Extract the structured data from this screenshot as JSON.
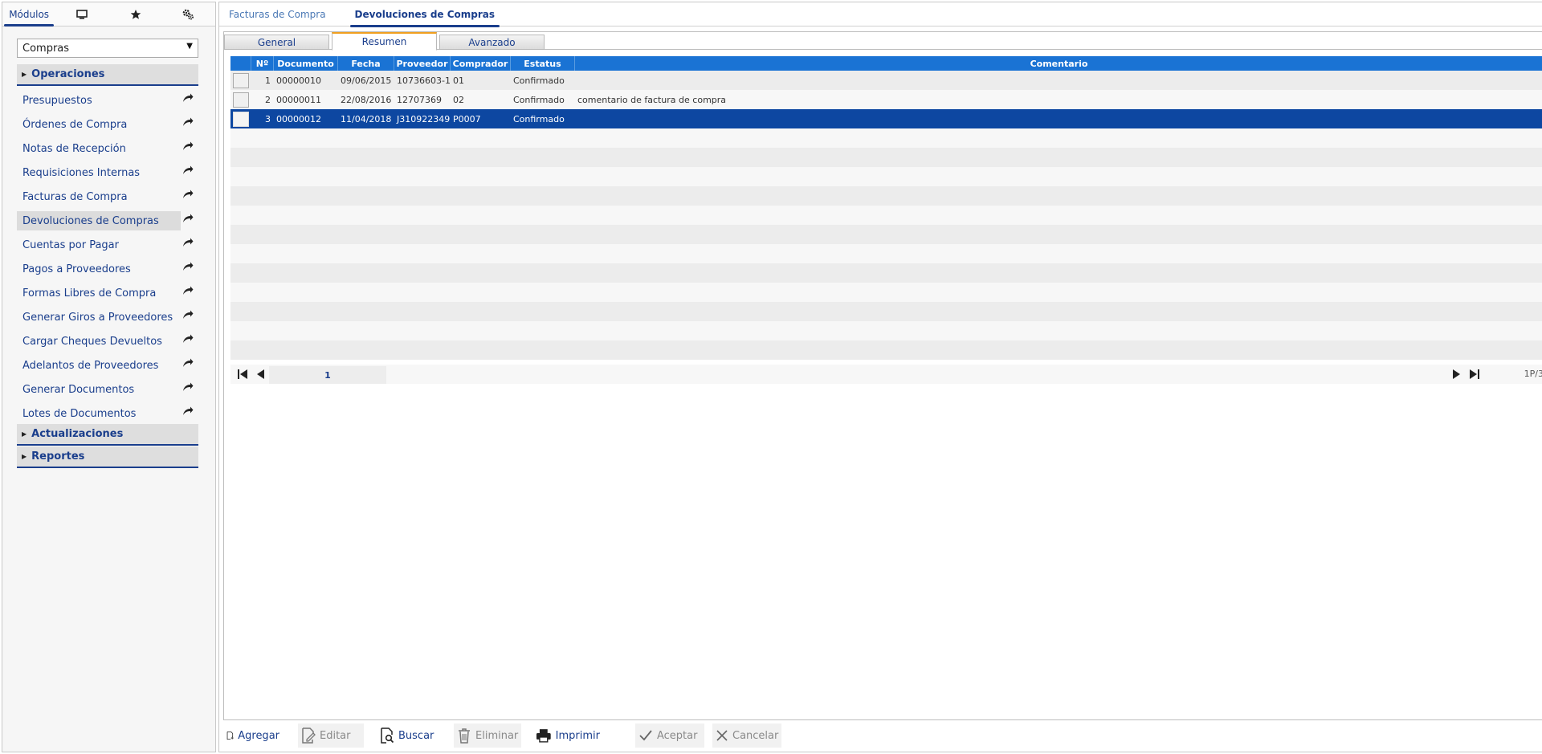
{
  "left_panel": {
    "tabs": [
      {
        "label": "Módulos",
        "icon": null
      },
      {
        "label": "",
        "icon": "monitor-icon"
      },
      {
        "label": "",
        "icon": "star-icon"
      },
      {
        "label": "",
        "icon": "gears-icon"
      }
    ],
    "module_select": {
      "value": "Compras"
    },
    "sections": {
      "operaciones": "Operaciones",
      "actualizaciones": "Actualizaciones",
      "reportes": "Reportes"
    },
    "menu_items": [
      "Presupuestos",
      "Órdenes de Compra",
      "Notas de Recepción",
      "Requisiciones Internas",
      "Facturas de Compra",
      "Devoluciones de Compras",
      "Cuentas por Pagar",
      "Pagos a Proveedores",
      "Formas Libres de Compra",
      "Generar Giros a Proveedores",
      "Cargar Cheques Devueltos",
      "Adelantos de Proveedores",
      "Generar Documentos",
      "Lotes de Documentos"
    ],
    "active_menu_item": "Devoluciones de Compras"
  },
  "document_tabs": [
    "Facturas de Compra",
    "Devoluciones de Compras"
  ],
  "active_document_tab": "Devoluciones de Compras",
  "sub_tabs": [
    "General",
    "Resumen",
    "Avanzado"
  ],
  "active_sub_tab": "Resumen",
  "grid": {
    "columns": [
      "Nº",
      "Documento",
      "Fecha",
      "Proveedor",
      "Comprador",
      "Estatus",
      "Comentario"
    ],
    "rows": [
      {
        "n": "1",
        "documento": "00000010",
        "fecha": "09/06/2015",
        "proveedor": "10736603-1",
        "comprador": "01",
        "estatus": "Confirmado",
        "comentario": ""
      },
      {
        "n": "2",
        "documento": "00000011",
        "fecha": "22/08/2016",
        "proveedor": "12707369",
        "comprador": "02",
        "estatus": "Confirmado",
        "comentario": "comentario de factura de compra"
      },
      {
        "n": "3",
        "documento": "00000012",
        "fecha": "11/04/2018",
        "proveedor": "J310922349",
        "comprador": "P0007",
        "estatus": "Confirmado",
        "comentario": ""
      }
    ],
    "selected_row": 3
  },
  "pager": {
    "page": "1",
    "info": "1P/3"
  },
  "toolbar": {
    "agregar": "Agregar",
    "editar": "Editar",
    "buscar": "Buscar",
    "eliminar": "Eliminar",
    "imprimir": "Imprimir",
    "aceptar": "Aceptar",
    "cancelar": "Cancelar"
  },
  "colors": {
    "accent": "#1a3e8c",
    "grid_header": "#1a73d4",
    "selected_row": "#0d47a1",
    "tab_highlight": "#f0a020"
  }
}
